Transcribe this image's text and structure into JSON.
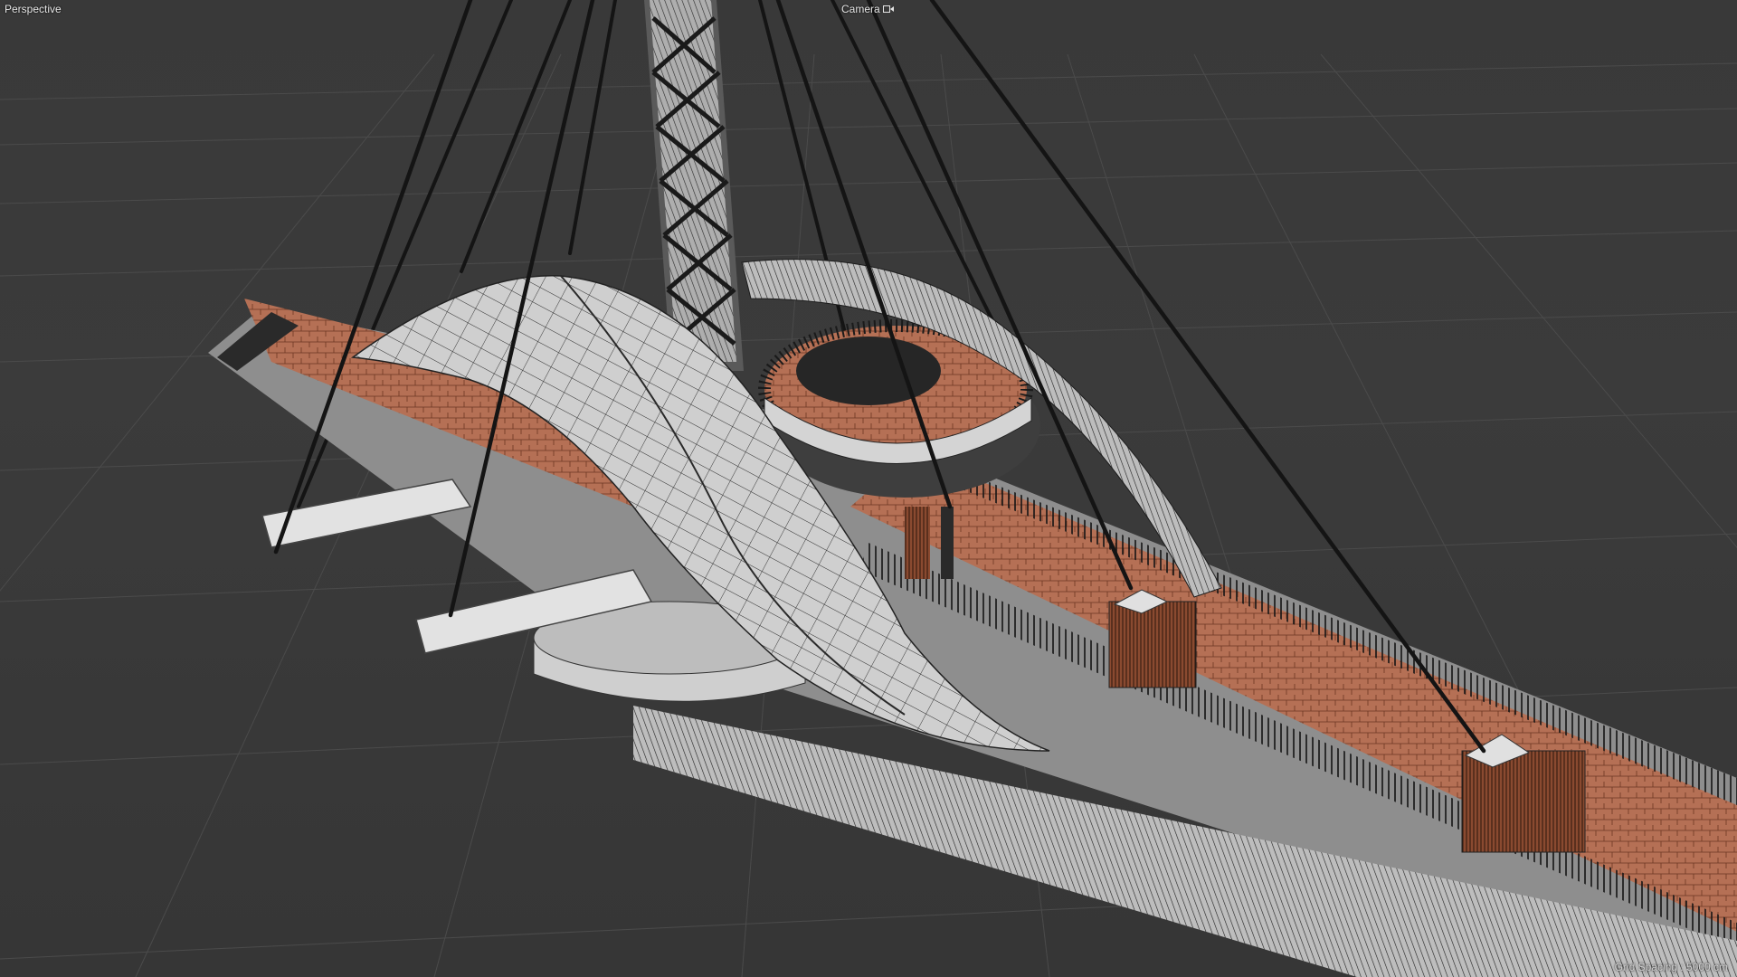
{
  "viewport": {
    "view_label": "Perspective",
    "camera_label": "Camera",
    "camera_icon": "camera-lock-icon",
    "grid_spacing_text": "Grid Spacing : 5000 cm"
  },
  "colors": {
    "background": "#3a3a3a",
    "grid": "#4a4a4a",
    "wood": "#b06a4a",
    "shell": "#d8d8d8",
    "wire": "#1e1e1e",
    "cable": "#151515"
  }
}
